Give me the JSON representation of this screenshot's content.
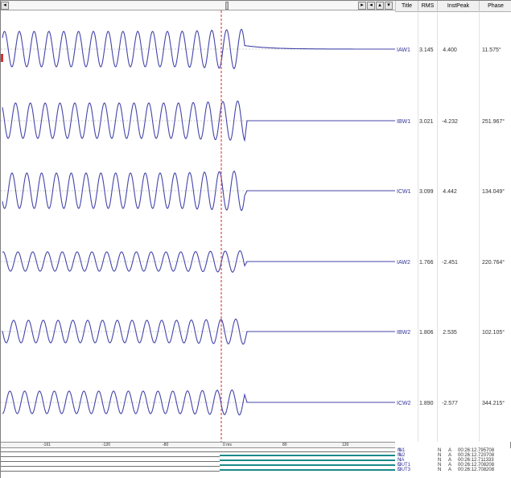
{
  "scroll": {
    "left_arrow": "◂",
    "right_arrow": "▸",
    "nav_icon_1": "◂",
    "nav_icon_2": "▴",
    "nav_icon_3": "▾"
  },
  "grid": {
    "columns": [
      "Title",
      "RMS",
      "InstPeak",
      "Phase"
    ]
  },
  "channels": [
    {
      "title": "IAW1",
      "rms": "3.145",
      "peak": "4.400",
      "phase": "11.575°"
    },
    {
      "title": "IBW1",
      "rms": "3.021",
      "peak": "-4.232",
      "phase": "251.967°"
    },
    {
      "title": "ICW1",
      "rms": "3.099",
      "peak": "4.442",
      "phase": "134.049°"
    },
    {
      "title": "IAW2",
      "rms": "1.766",
      "peak": "-2.451",
      "phase": "220.764°"
    },
    {
      "title": "IBW2",
      "rms": "1.806",
      "peak": "2.535",
      "phase": "102.105°"
    },
    {
      "title": "ICW2",
      "rms": "1.890",
      "peak": "-2.577",
      "phase": "344.215°"
    }
  ],
  "time_axis": {
    "labels": [
      "-161",
      "-120",
      "-80",
      "0 ms",
      "80",
      "120"
    ]
  },
  "digital": [
    {
      "state": "N",
      "name": "IN1",
      "flag": "N",
      "mode": "A",
      "time": "00:26:12.795708"
    },
    {
      "state": "N",
      "name": "IN2",
      "flag": "N",
      "mode": "A",
      "time": "00:26:12.720708"
    },
    {
      "state": "N",
      "name": "NA",
      "flag": "N",
      "mode": "A",
      "time": "00:26:12.711333"
    },
    {
      "state": "N",
      "name": "OUT1",
      "flag": "N",
      "mode": "A",
      "time": "00:26:12.708208"
    },
    {
      "state": "N",
      "name": "OUT3",
      "flag": "N",
      "mode": "A",
      "time": "00:26:12.708208"
    }
  ],
  "colors": {
    "waveform": "#4444aa",
    "cursor": "#dd2222",
    "baseline": "#9a9a9a",
    "digital_high": "#1a8a8a"
  }
}
